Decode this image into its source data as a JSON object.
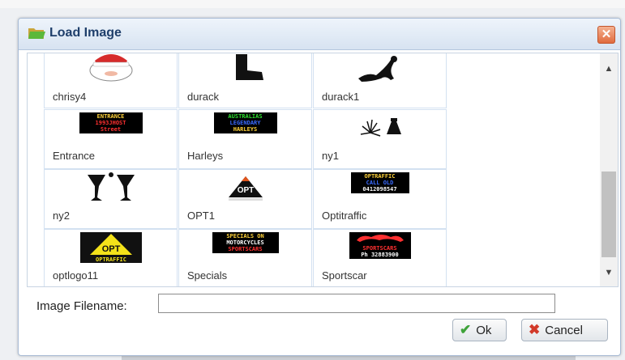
{
  "dialog": {
    "title": "Load Image",
    "close_label": "✕"
  },
  "items": [
    {
      "label": "chrisy4",
      "icon": "santa-image"
    },
    {
      "label": "durack",
      "icon": "boot-image"
    },
    {
      "label": "durack1",
      "icon": "silhouette-image"
    },
    {
      "label": "Entrance",
      "icon": "entrance-sign-image",
      "lines": [
        "ENTRANCE",
        "1993JHOST",
        "Street"
      ],
      "colors": [
        "#ffd23a",
        "#ff3030",
        "#ff3030"
      ]
    },
    {
      "label": "Harleys",
      "icon": "harleys-sign-image",
      "lines": [
        "AUSTRALIAS",
        "LEGENDARY",
        "HARLEYS"
      ],
      "colors": [
        "#2fe02f",
        "#3a6bff",
        "#ffd23a"
      ]
    },
    {
      "label": "ny1",
      "icon": "fireworks-image"
    },
    {
      "label": "ny2",
      "icon": "champagne-glasses-image"
    },
    {
      "label": "OPT1",
      "icon": "opt-logo-image",
      "text": "OPT"
    },
    {
      "label": "Optitraffic",
      "icon": "optitraffic-sign-image",
      "lines": [
        "OPTRAFFIC",
        "CALL OLD",
        "0412098547"
      ],
      "colors": [
        "#ffd23a",
        "#3a6bff",
        "#ffffff"
      ]
    },
    {
      "label": "optlogo11",
      "icon": "opt-yellow-logo-image",
      "text": "OPT",
      "subtext": "OPTRAFFIC"
    },
    {
      "label": "Specials",
      "icon": "specials-sign-image",
      "lines": [
        "SPECIALS ON",
        "MOTORCYCLES",
        "SPORTSCARS"
      ],
      "colors": [
        "#ffd23a",
        "#ffffff",
        "#ff3030"
      ]
    },
    {
      "label": "Sportscar",
      "icon": "sportscar-sign-image",
      "lines": [
        "SPORTSCARS",
        "Ph 32883900"
      ],
      "colors": [
        "#ff3030",
        "#ffffff"
      ]
    }
  ],
  "filename": {
    "label": "Image Filename:",
    "value": "",
    "placeholder": ""
  },
  "buttons": {
    "ok": "Ok",
    "cancel": "Cancel"
  },
  "scrollbar": {
    "up": "▲",
    "down": "▼"
  }
}
